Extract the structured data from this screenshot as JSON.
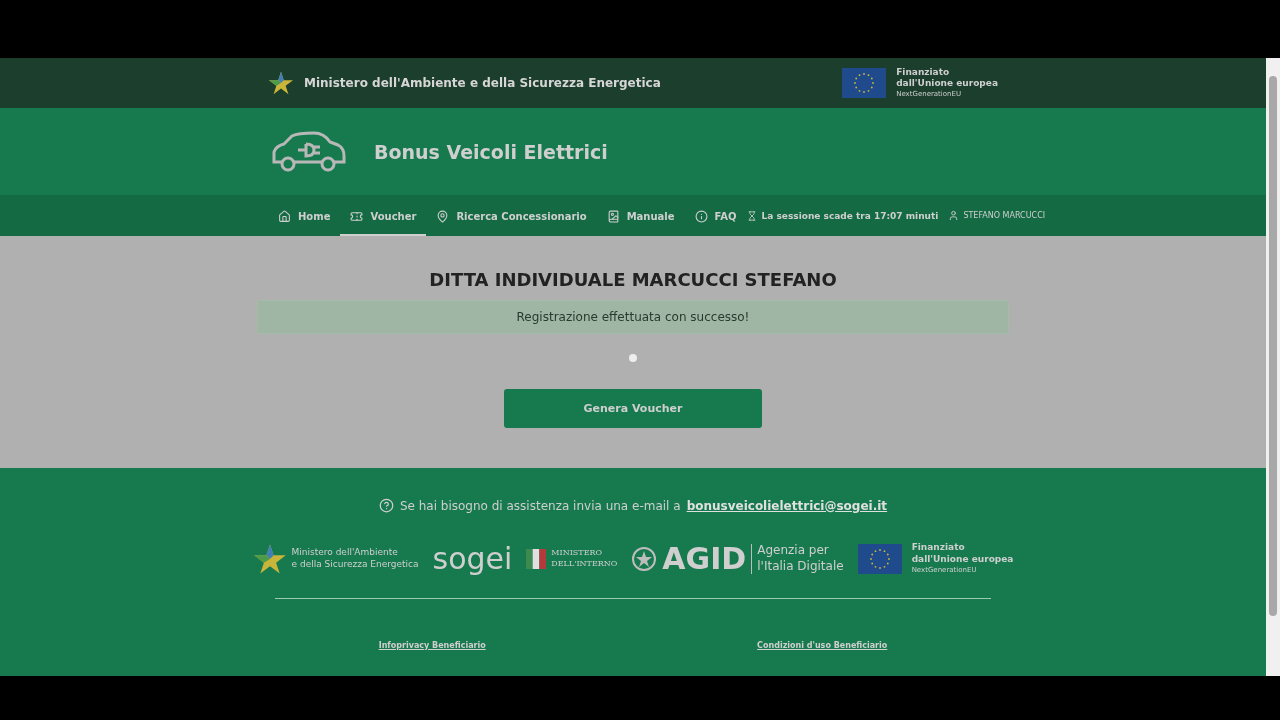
{
  "top_bar": {
    "ministry": "Ministero dell'Ambiente e della Sicurezza Energetica",
    "eu_lines": [
      "Finanziato",
      "dall'Unione europea",
      "NextGenerationEU"
    ]
  },
  "banner": {
    "title": "Bonus Veicoli Elettrici"
  },
  "nav": {
    "items": [
      {
        "kind": "home",
        "label": "Home",
        "selected": false
      },
      {
        "kind": "voucher",
        "label": "Voucher",
        "selected": true
      },
      {
        "kind": "pin",
        "label": "Ricerca Concessionario",
        "selected": false
      },
      {
        "kind": "manual",
        "label": "Manuale",
        "selected": false
      },
      {
        "kind": "info",
        "label": "FAQ",
        "selected": false
      }
    ],
    "session": "La sessione scade tra 17:07 minuti",
    "user": "STEFANO MARCUCCI"
  },
  "content": {
    "heading": "DITTA INDIVIDUALE MARCUCCI STEFANO",
    "alert": "Registrazione effettuata con successo!",
    "button": "Genera Voucher"
  },
  "footer": {
    "help": "Se hai bisogno di assistenza invia una e-mail a",
    "email": "bonusveicolielettrici@sogei.it",
    "ministry_lines": [
      "Ministero dell'Ambiente",
      "e della Sicurezza Energetica"
    ],
    "sogei": "sogei",
    "interno_lines": [
      "MINISTERO",
      "DELL'INTERNO"
    ],
    "agid": "AGID",
    "agid_lines": [
      "Agenzia per",
      "l'Italia Digitale"
    ],
    "eu_lines": [
      "Finanziato",
      "dall'Unione europea",
      "NextGenerationEU"
    ],
    "links": [
      "Infoprivacy Beneficiario",
      "Condizioni d'uso Beneficiario"
    ]
  }
}
